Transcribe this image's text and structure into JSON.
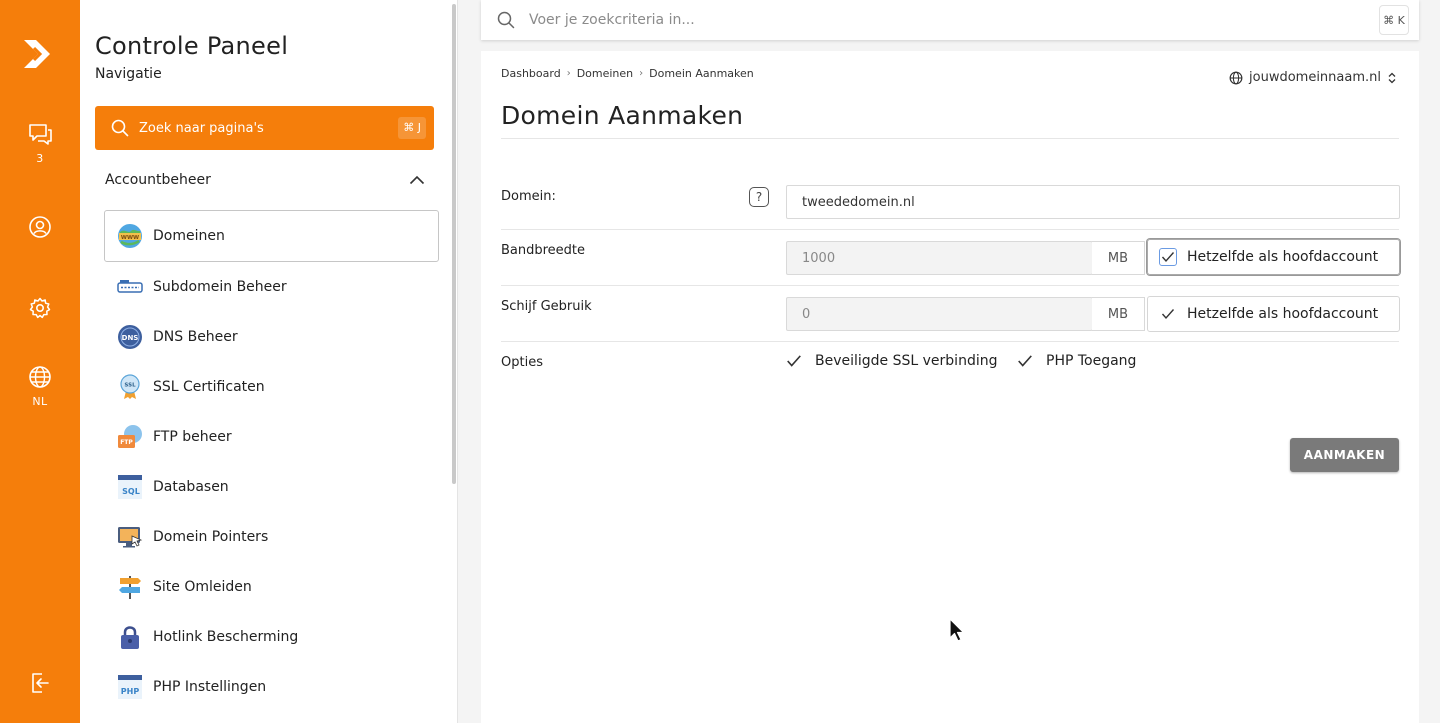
{
  "rail": {
    "chat_count": "3",
    "language": "NL"
  },
  "sidebar": {
    "title": "Controle Paneel",
    "subtitle": "Navigatie",
    "search_placeholder": "Zoek naar pagina's",
    "search_shortcut": "⌘ J",
    "section_title": "Accountbeheer",
    "items": [
      {
        "label": "Domeinen",
        "icon": "www-globe-icon"
      },
      {
        "label": "Subdomein Beheer",
        "icon": "subdomain-icon"
      },
      {
        "label": "DNS Beheer",
        "icon": "dns-icon"
      },
      {
        "label": "SSL Certificaten",
        "icon": "ssl-badge-icon"
      },
      {
        "label": "FTP beheer",
        "icon": "ftp-folder-icon"
      },
      {
        "label": "Databasen",
        "icon": "sql-icon"
      },
      {
        "label": "Domein Pointers",
        "icon": "pointer-monitor-icon"
      },
      {
        "label": "Site Omleiden",
        "icon": "signpost-icon"
      },
      {
        "label": "Hotlink Bescherming",
        "icon": "padlock-icon"
      },
      {
        "label": "PHP Instellingen",
        "icon": "php-icon"
      }
    ]
  },
  "topbar": {
    "search_placeholder": "Voer je zoekcriteria in...",
    "shortcut": "⌘ K"
  },
  "breadcrumb": [
    "Dashboard",
    "Domeinen",
    "Domein Aanmaken"
  ],
  "domain_selector": "jouwdomeinnaam.nl",
  "page_title": "Domein Aanmaken",
  "form": {
    "domain_label": "Domein:",
    "domain_value": "tweededomein.nl",
    "help_symbol": "?",
    "bandwidth_label": "Bandbreedte",
    "bandwidth_value": "1000",
    "bandwidth_unit": "MB",
    "bandwidth_same": "Hetzelfde als hoofdaccount",
    "disk_label": "Schijf Gebruik",
    "disk_value": "0",
    "disk_unit": "MB",
    "disk_same": "Hetzelfde als hoofdaccount",
    "options_label": "Opties",
    "option_ssl": "Beveiligde SSL verbinding",
    "option_php": "PHP Toegang",
    "submit": "AANMAKEN"
  },
  "colors": {
    "brand_orange": "#f57e0b",
    "button_grey": "#7a7a7a"
  }
}
